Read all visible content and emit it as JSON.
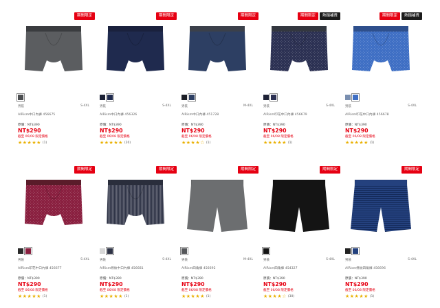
{
  "badge_limited": "期間限定",
  "badge_restock": "熱銷補貨",
  "gender_label": "男裝",
  "orig_label": "原價",
  "colors": {
    "red": "#e60012",
    "star": "#e9b000"
  },
  "products": [
    {
      "garment_color": "#5b5d60",
      "waistband_color": "#3a3c3f",
      "style": "plain",
      "swatches": [
        "#4b4d50"
      ],
      "sizes": "S-4XL",
      "name": "AIRism中口內褲 456675",
      "orig_price": "NT$390",
      "price": "NT$290",
      "promo": "截至 06/08 限定價格",
      "stars": "★★★★★",
      "rating": 5,
      "count": "(1)",
      "badges": [
        "badge_limited"
      ]
    },
    {
      "garment_color": "#1f2a4e",
      "waistband_color": "#1a213d",
      "style": "plain",
      "swatches": [
        "#1b2035",
        "#1f2a4e"
      ],
      "sizes": "S-4XL",
      "name": "AIRism中口內褲 456326",
      "orig_price": "NT$390",
      "price": "NT$290",
      "promo": "截至 06/08 限定價格",
      "stars": "★★★★★",
      "rating": 5,
      "count": "(20)",
      "badges": [
        "badge_limited"
      ]
    },
    {
      "garment_color": "#2d3f63",
      "waistband_color": "#3b404a",
      "style": "plain",
      "swatches": [
        "#1b1e26",
        "#2d3f63"
      ],
      "sizes": "M-4XL",
      "name": "AIRism中口內褲 451728",
      "orig_price": "NT$390",
      "price": "NT$290",
      "promo": "截至 06/08 限定價格",
      "stars": "★★★★☆",
      "rating": 4,
      "count": "(1)",
      "badges": [
        "badge_limited"
      ]
    },
    {
      "garment_color": "#2c3153",
      "waistband_color": "#33373f",
      "style": "pattern",
      "swatches": [
        "#1e2236",
        "#2c3153"
      ],
      "sizes": "S-4XL",
      "name": "AIRism印花中口內褲 456679",
      "orig_price": "NT$390",
      "price": "NT$290",
      "promo": "截至 06/08 限定價格",
      "stars": "★★★★★",
      "rating": 5,
      "count": "(1)",
      "badges": [
        "badge_limited",
        "badge_restock"
      ]
    },
    {
      "garment_color": "#3f6fc4",
      "waistband_color": "#2e4f8c",
      "style": "pattern",
      "swatches": [
        "#7a8fb0",
        "#3f6fc4"
      ],
      "sizes": "S-4XL",
      "name": "AIRism印花中口內褲 456678",
      "orig_price": "NT$390",
      "price": "NT$290",
      "promo": "截至 06/08 限定價格",
      "stars": "★★★★★",
      "rating": 5,
      "count": "(1)",
      "badges": [
        "badge_limited",
        "badge_restock"
      ]
    },
    {
      "garment_color": "#8a2040",
      "waistband_color": "#5a1c2a",
      "style": "pattern",
      "swatches": [
        "#2a2a2a",
        "#8a2040"
      ],
      "sizes": "S-4XL",
      "name": "AIRism印花中口內褲 456677",
      "orig_price": "NT$390",
      "price": "NT$290",
      "promo": "截至 06/08 限定價格",
      "stars": "★★★★★",
      "rating": 5,
      "count": "(1)",
      "badges": [
        "badge_limited"
      ]
    },
    {
      "garment_color": "#2e3346",
      "waistband_color": "#2a2e3c",
      "style": "stripe-v",
      "swatches": [
        "#d8d8d8",
        "#2e3346"
      ],
      "sizes": "S-4XL",
      "name": "AIRism條紋中口內褲 456681",
      "orig_price": "NT$390",
      "price": "NT$290",
      "promo": "截至 06/08 限定價格",
      "stars": "★★★★★",
      "rating": 5,
      "count": "(1)",
      "badges": [
        "badge_limited"
      ]
    },
    {
      "garment_color": "#6c6e70",
      "waistband_color": "#6c6e70",
      "style": "boxer",
      "swatches": [
        "#55575a"
      ],
      "sizes": "M-4XL",
      "name": "AIRism四角褲 456692",
      "orig_price": "NT$390",
      "price": "NT$290",
      "promo": "截至 06/08 限定價格",
      "stars": "★★★★★",
      "rating": 5,
      "count": "(1)",
      "badges": [
        "badge_limited"
      ]
    },
    {
      "garment_color": "#141414",
      "waistband_color": "#141414",
      "style": "boxer",
      "swatches": [
        "#141414"
      ],
      "sizes": "S-4XL",
      "name": "AIRism四角褲 454327",
      "orig_price": "NT$390",
      "price": "NT$290",
      "promo": "截至 06/08 限定價格",
      "stars": "★★★★☆",
      "rating": 4.5,
      "count": "(30)",
      "badges": [
        "badge_limited"
      ]
    },
    {
      "garment_color": "#24417e",
      "waistband_color": "#24417e",
      "style": "boxer-stripe",
      "swatches": [
        "#222222",
        "#24417e"
      ],
      "sizes": "S-4XL",
      "name": "AIRism條紋四角褲 456696",
      "orig_price": "NT$390",
      "price": "NT$290",
      "promo": "截至 06/08 限定價格",
      "stars": "★★★★★",
      "rating": 5,
      "count": "(1)",
      "badges": [
        "badge_limited"
      ]
    }
  ]
}
